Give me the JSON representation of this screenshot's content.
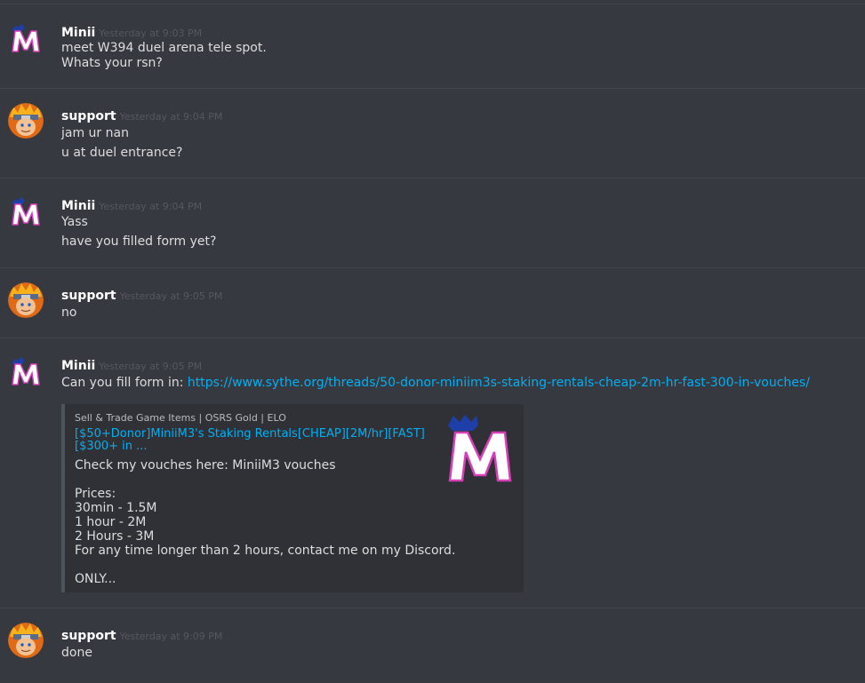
{
  "messages": [
    {
      "author": "Minii",
      "timestamp": "Yesterday at 9:03 PM",
      "lines": [
        "meet W394 duel arena tele spot.",
        "Whats your rsn?"
      ]
    },
    {
      "author": "support",
      "timestamp": "Yesterday at 9:04 PM",
      "lines": [
        "jam ur nan",
        "u at duel entrance?"
      ]
    },
    {
      "author": "Minii",
      "timestamp": "Yesterday at 9:04 PM",
      "lines": [
        "Yass",
        "have you filled form yet?"
      ]
    },
    {
      "author": "support",
      "timestamp": "Yesterday at 9:05 PM",
      "lines": [
        "no"
      ]
    },
    {
      "author": "Minii",
      "timestamp": "Yesterday at 9:05 PM",
      "text_prefix": "Can you fill form in: ",
      "link": "https://www.sythe.org/threads/50-donor-miniim3s-staking-rentals-cheap-2m-hr-fast-300-in-vouches/",
      "embed": {
        "provider": "Sell & Trade Game Items | OSRS Gold | ELO",
        "title": "[$50+Donor]MiniiM3's Staking Rentals[CHEAP][2M/hr][FAST][$300+ in ...",
        "description_lines": [
          "Check my vouches here: MiniiM3 vouches",
          "",
          "Prices:",
          "30min - 1.5M",
          "1 hour - 2M",
          "2 Hours - 3M",
          "For any time longer than 2 hours, contact me on my Discord.",
          "",
          "ONLY..."
        ],
        "thumbnail_icon": "minii-m-logo-icon"
      }
    },
    {
      "author": "support",
      "timestamp": "Yesterday at 9:09 PM",
      "lines": [
        "done"
      ]
    }
  ],
  "colors": {
    "background": "#36393f",
    "username": "#ffffff",
    "timestamp": "#55585d",
    "text": "#dcddde",
    "link": "#00b0f4",
    "embed_background": "#2f3136",
    "divider": "#42454a"
  }
}
